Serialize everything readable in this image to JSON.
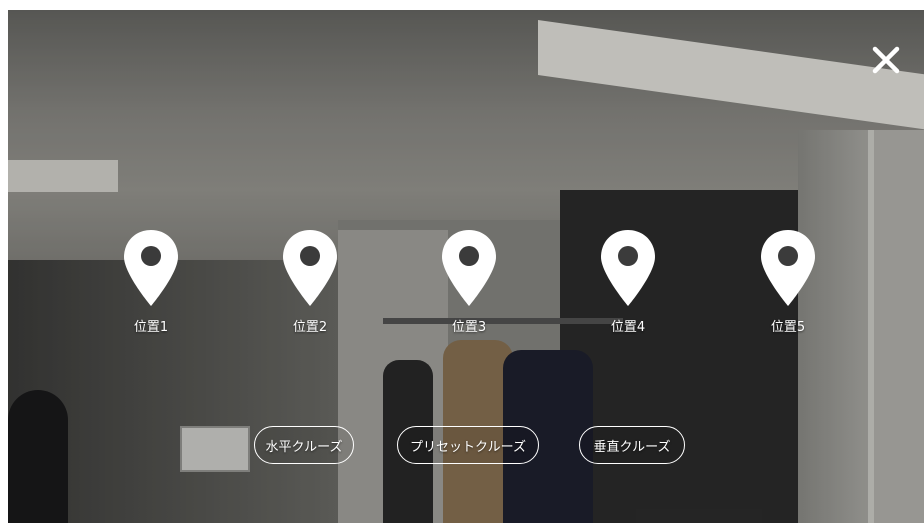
{
  "close": {
    "icon": "close-icon"
  },
  "markers": [
    {
      "label": "位置1",
      "icon": "location-pin-icon"
    },
    {
      "label": "位置2",
      "icon": "location-pin-icon"
    },
    {
      "label": "位置3",
      "icon": "location-pin-icon"
    },
    {
      "label": "位置4",
      "icon": "location-pin-icon"
    },
    {
      "label": "位置5",
      "icon": "location-pin-icon"
    }
  ],
  "cruise": {
    "horizontal": "水平クルーズ",
    "preset": "プリセットクルーズ",
    "vertical": "垂直クルーズ"
  },
  "colors": {
    "overlay_text": "#ffffff"
  }
}
